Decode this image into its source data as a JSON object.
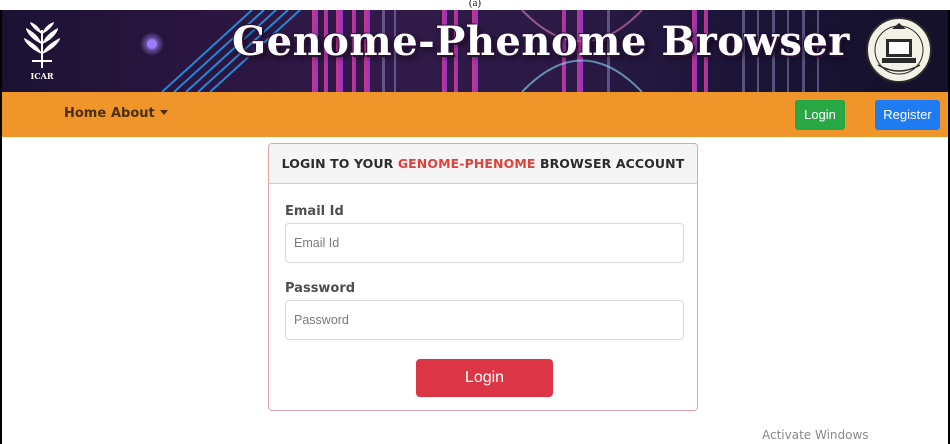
{
  "page": {
    "top_caption": "(a)"
  },
  "header": {
    "title": "Genome-Phenome Browser",
    "left_logo_text": "ICAR",
    "left_logo_icon": "wheat-emblem-icon",
    "right_logo_icon": "institute-emblem-icon"
  },
  "nav": {
    "home_label": "Home",
    "about_label": "About",
    "login_label": "Login",
    "register_label": "Register",
    "colors": {
      "bar": "#f0952a",
      "login": "#28a745",
      "register": "#1e7bf2"
    }
  },
  "login_card": {
    "heading_prefix": "LOGIN TO YOUR ",
    "heading_accent": "GENOME-PHENOME",
    "heading_suffix": " BROWSER ACCOUNT",
    "email_label": "Email Id",
    "email_placeholder": "Email Id",
    "email_value": "",
    "password_label": "Password",
    "password_placeholder": "Password",
    "password_value": "",
    "submit_label": "Login",
    "colors": {
      "accent": "#e0413a",
      "submit": "#dc3545"
    }
  },
  "os_watermark": {
    "text": "Activate Windows"
  }
}
